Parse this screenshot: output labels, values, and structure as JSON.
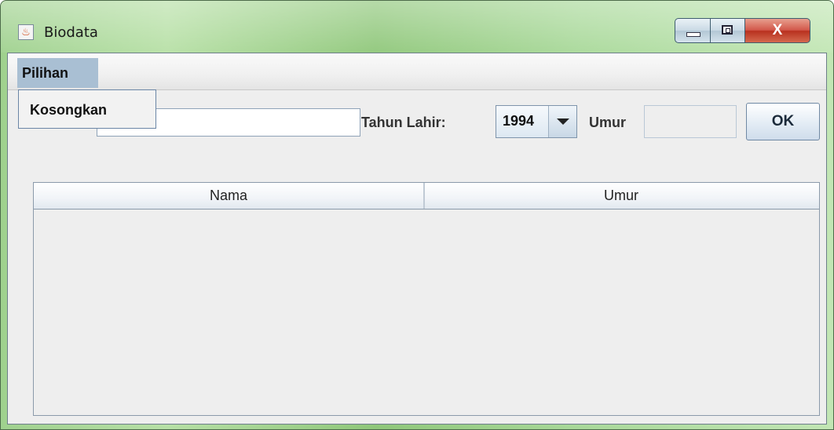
{
  "window": {
    "title": "Biodata",
    "icon": "java-icon",
    "controls": {
      "minimize": "minimize-icon",
      "maximize": "maximize-icon",
      "close_label": "X"
    }
  },
  "menubar": {
    "menus": [
      {
        "label": "Pilihan",
        "open": true
      }
    ],
    "open_menu_items": [
      {
        "label": "Kosongkan"
      }
    ]
  },
  "form": {
    "nama_value": "",
    "tahun_label": "Tahun Lahir:",
    "tahun_selected": "1994",
    "umur_label": "Umur",
    "umur_value": "",
    "ok_label": "OK"
  },
  "table": {
    "columns": [
      "Nama",
      "Umur"
    ],
    "rows": []
  },
  "colors": {
    "frame_accent": "#9fd18e",
    "menu_highlight": "#a9bfd3",
    "client_bg": "#eeeeee"
  }
}
